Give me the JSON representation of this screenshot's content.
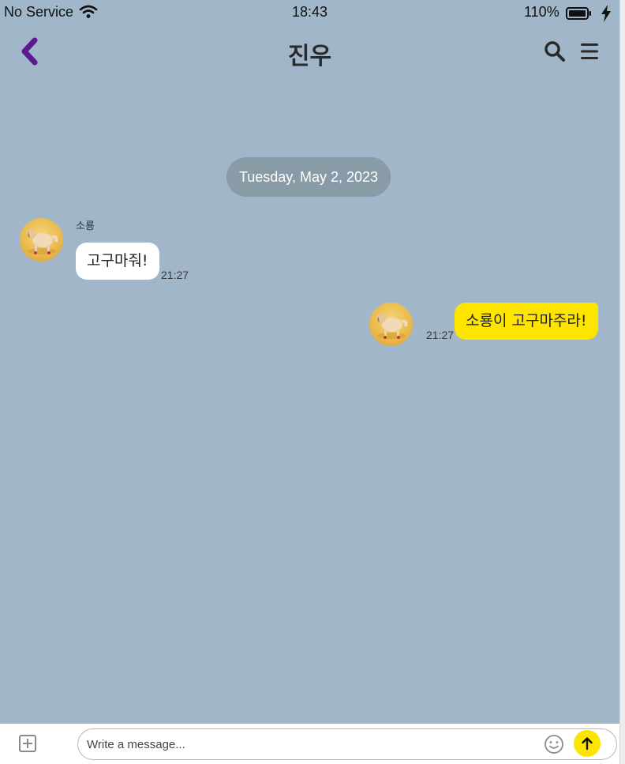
{
  "status_bar": {
    "carrier": "No Service",
    "time": "18:43",
    "battery_percent": "110%"
  },
  "header": {
    "title": "진우",
    "back_icon": "chevron-left-icon",
    "search_icon": "search-icon",
    "menu_icon": "hamburger-menu-icon"
  },
  "chat": {
    "date_divider": "Tuesday, May 2, 2023",
    "messages": [
      {
        "direction": "incoming",
        "sender": "소룡",
        "text": "고구마줘!",
        "time": "21:27"
      },
      {
        "direction": "outgoing",
        "text": "소룡이 고구마주라!",
        "time": "21:27"
      }
    ]
  },
  "input_bar": {
    "placeholder": "Write a message...",
    "value": "",
    "attach_icon": "plus-square-icon",
    "emoji_icon": "smiley-icon",
    "send_icon": "arrow-up-icon"
  },
  "colors": {
    "chat_background": "#a1b7c9",
    "outgoing_bubble": "#fee500",
    "incoming_bubble": "#ffffff",
    "back_button": "#5b1a8e",
    "date_pill": "#8a9ba8"
  }
}
